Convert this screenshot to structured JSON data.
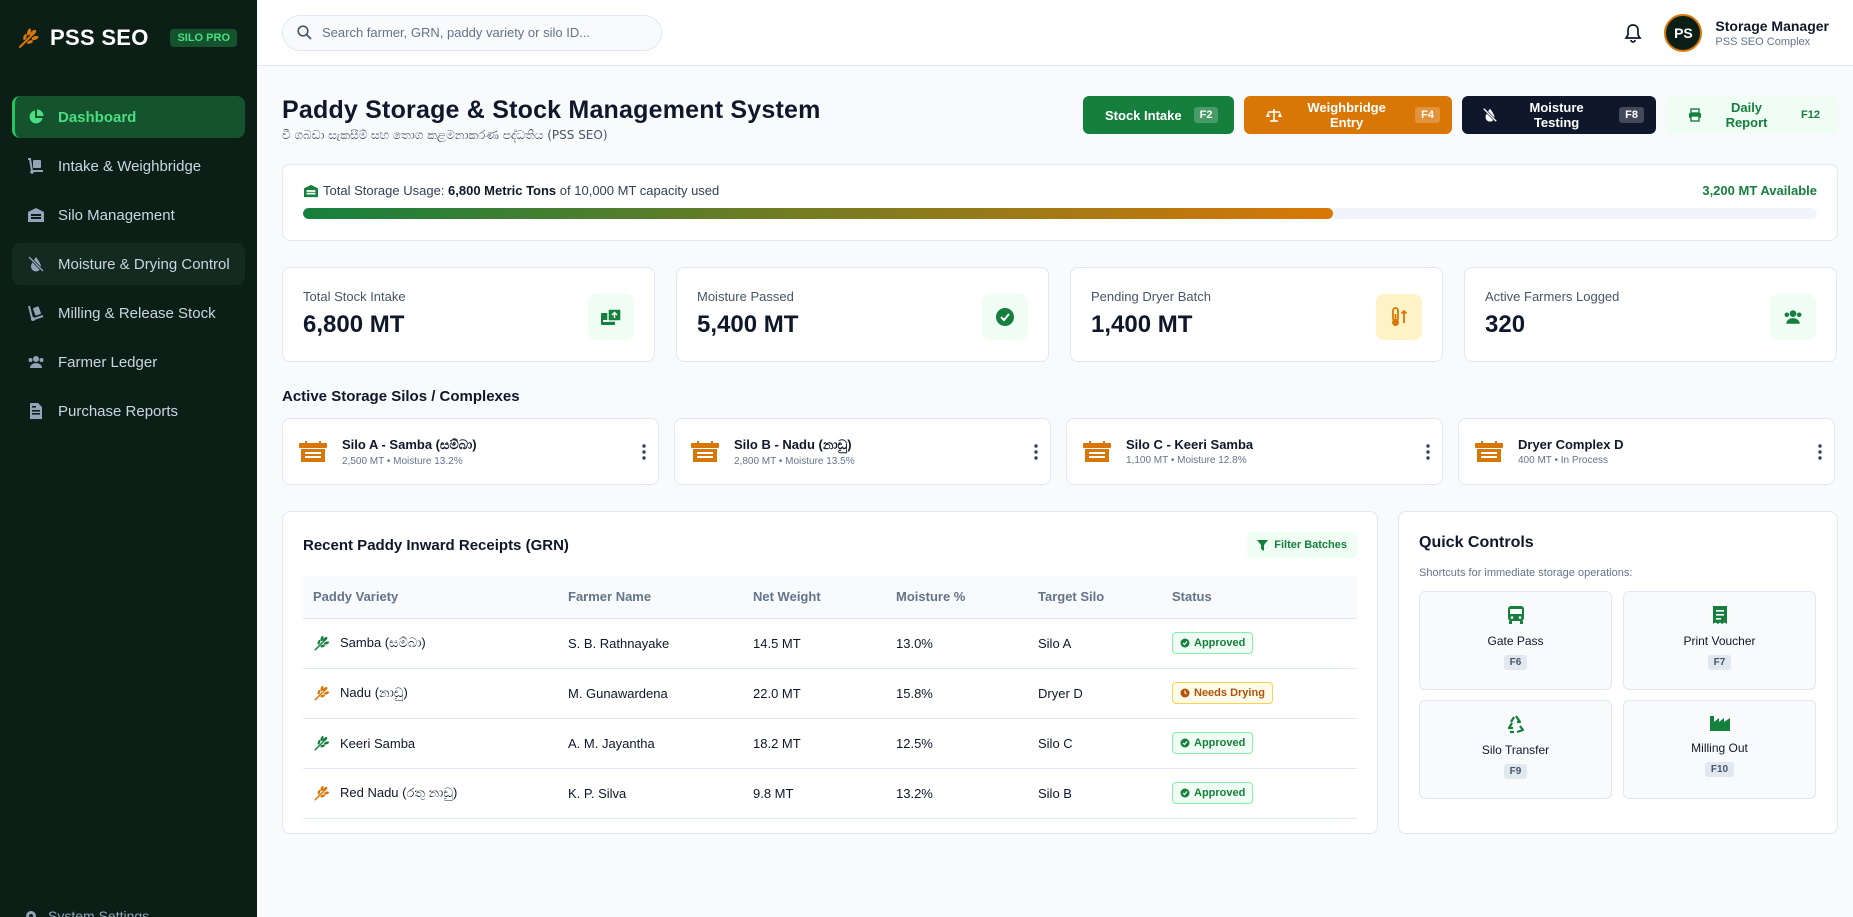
{
  "brand": {
    "name": "PSS SEO",
    "badge": "SILO PRO"
  },
  "sidebar": {
    "items": [
      {
        "label": "Dashboard"
      },
      {
        "label": "Intake & Weighbridge"
      },
      {
        "label": "Silo Management"
      },
      {
        "label": "Moisture & Drying Control"
      },
      {
        "label": "Milling & Release Stock"
      },
      {
        "label": "Farmer Ledger"
      },
      {
        "label": "Purchase Reports"
      }
    ],
    "settings_label": "System Settings"
  },
  "search": {
    "placeholder": "Search farmer, GRN, paddy variety or silo ID..."
  },
  "user": {
    "initials": "PS",
    "name": "Storage Manager",
    "subtitle": "PSS SEO Complex"
  },
  "header": {
    "title": "Paddy Storage & Stock Management System",
    "subtitle": "වී ගබඩා සැකසීම් සහ තොග කළමනාකරණ පද්ධතිය (PSS SEO)"
  },
  "actions": [
    {
      "label": "Stock Intake",
      "key": "F2"
    },
    {
      "label": "Weighbridge Entry",
      "key": "F4"
    },
    {
      "label": "Moisture Testing",
      "key": "F8"
    },
    {
      "label": "Daily Report",
      "key": "F12"
    }
  ],
  "usage": {
    "prefix": "Total Storage Usage:",
    "used": "6,800 Metric Tons",
    "suffix": "of 10,000 MT capacity used",
    "available": "3,200 MT Available",
    "fraction_used": 0.68
  },
  "stats": [
    {
      "label": "Total Stock Intake",
      "value": "6,800 MT"
    },
    {
      "label": "Moisture Passed",
      "value": "5,400 MT"
    },
    {
      "label": "Pending Dryer Batch",
      "value": "1,400 MT"
    },
    {
      "label": "Active Farmers Logged",
      "value": "320"
    }
  ],
  "silos_section": {
    "title": "Active Storage Silos / Complexes"
  },
  "silos": [
    {
      "name": "Silo A - Samba (සම්බා)",
      "meta": "2,500 MT • Moisture 13.2%"
    },
    {
      "name": "Silo B - Nadu (නාඩු)",
      "meta": "2,800 MT • Moisture 13.5%"
    },
    {
      "name": "Silo C - Keeri Samba",
      "meta": "1,100 MT • Moisture 12.8%"
    },
    {
      "name": "Dryer Complex D",
      "meta": "400 MT • In Process"
    }
  ],
  "receipts": {
    "title": "Recent Paddy Inward Receipts (GRN)",
    "filter_label": "Filter Batches",
    "columns": [
      "Paddy Variety",
      "Farmer Name",
      "Net Weight",
      "Moisture %",
      "Target Silo",
      "Status"
    ],
    "rows": [
      {
        "variety": "Samba (සම්බා)",
        "farmer": "S. B. Rathnayake",
        "weight": "14.5 MT",
        "moisture": "13.0%",
        "silo": "Silo A",
        "status": "Approved"
      },
      {
        "variety": "Nadu (නාඩු)",
        "farmer": "M. Gunawardena",
        "weight": "22.0 MT",
        "moisture": "15.8%",
        "silo": "Dryer D",
        "status": "Needs Drying"
      },
      {
        "variety": "Keeri Samba",
        "farmer": "A. M. Jayantha",
        "weight": "18.2 MT",
        "moisture": "12.5%",
        "silo": "Silo C",
        "status": "Approved"
      },
      {
        "variety": "Red Nadu (රතු නාඩු)",
        "farmer": "K. P. Silva",
        "weight": "9.8 MT",
        "moisture": "13.2%",
        "silo": "Silo B",
        "status": "Approved"
      }
    ]
  },
  "quick": {
    "title": "Quick Controls",
    "subtitle": "Shortcuts for immediate storage operations:",
    "items": [
      {
        "label": "Gate Pass",
        "key": "F6"
      },
      {
        "label": "Print Voucher",
        "key": "F7"
      },
      {
        "label": "Silo Transfer",
        "key": "F9"
      },
      {
        "label": "Milling Out",
        "key": "F10"
      }
    ]
  },
  "colors": {
    "sidebar_bg": "#0c1f17",
    "primary_green": "#15803d",
    "accent_orange": "#d97706",
    "dark": "#0f172a"
  }
}
